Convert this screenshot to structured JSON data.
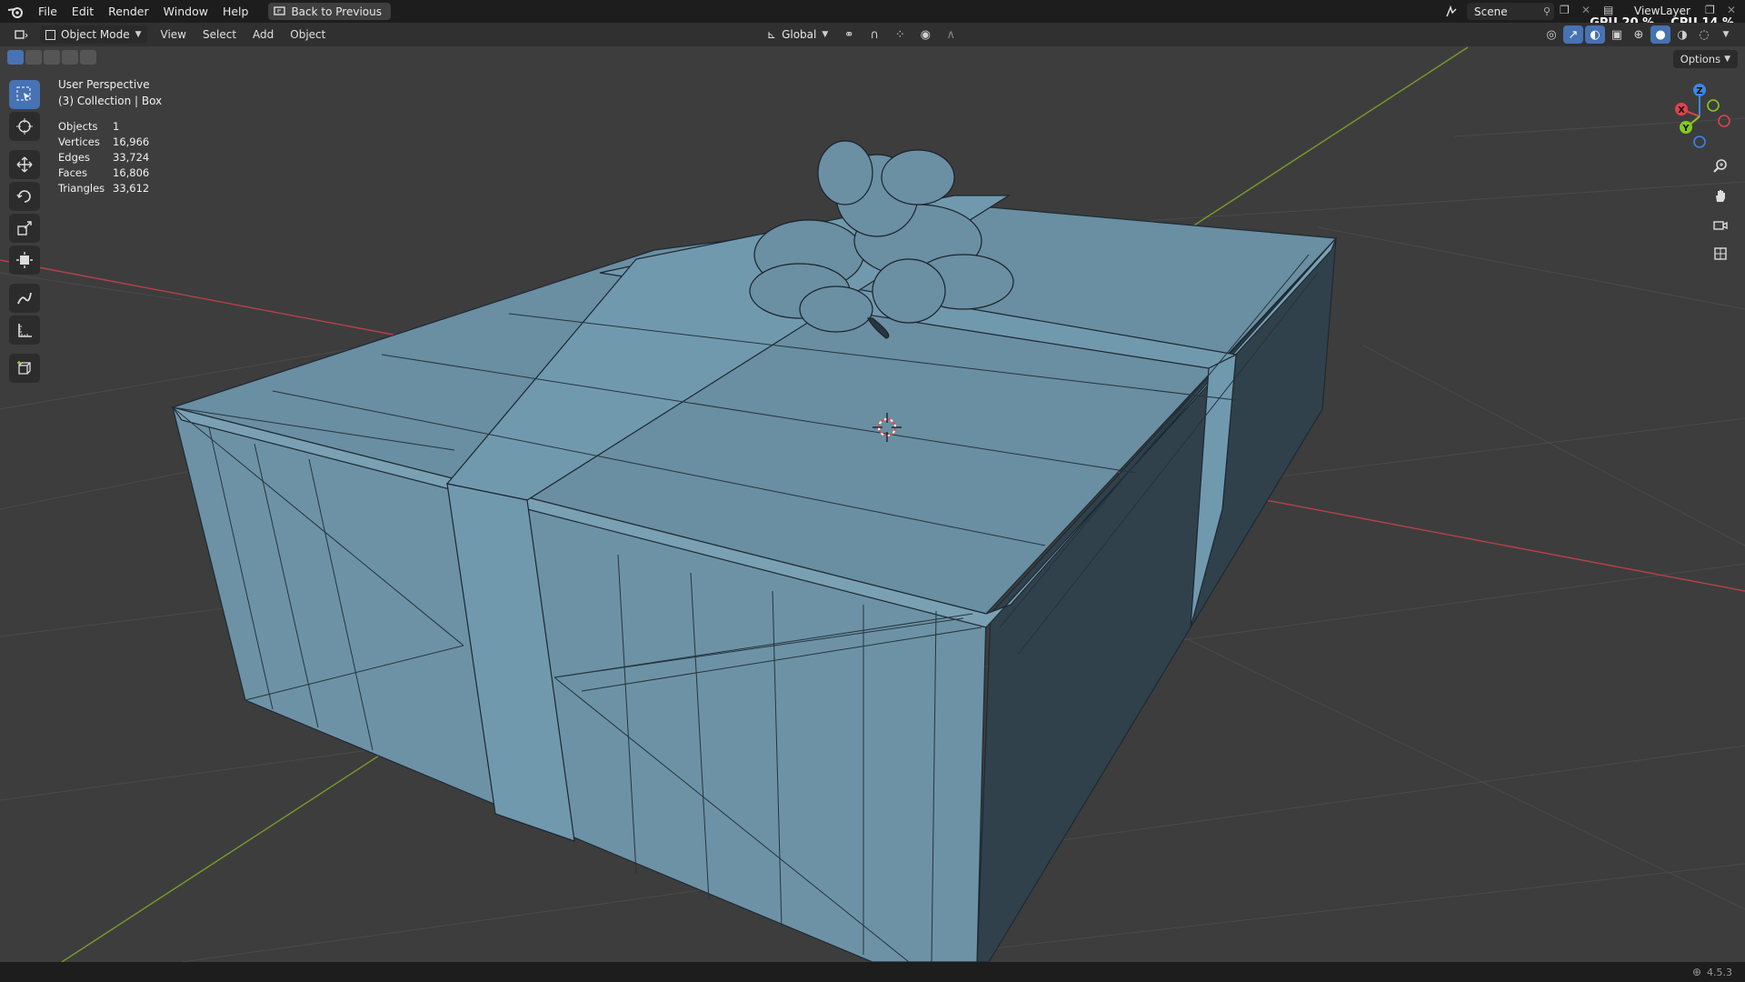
{
  "menu": {
    "file": "File",
    "edit": "Edit",
    "render": "Render",
    "window": "Window",
    "help": "Help",
    "back_to_previous": "Back to Previous"
  },
  "scene": {
    "label": "Scene"
  },
  "view_layer": {
    "label": "ViewLayer"
  },
  "performance": {
    "gpu_label": "GPU",
    "gpu_value": "20 %",
    "cpu_label": "CPU",
    "cpu_value": "14 %"
  },
  "header": {
    "mode": "Object Mode",
    "view": "View",
    "select": "Select",
    "add": "Add",
    "object": "Object",
    "transform_orientation": "Global",
    "options": "Options"
  },
  "viewport": {
    "perspective": "User Perspective",
    "collection": "(3) Collection | Box",
    "stats": [
      {
        "label": "Objects",
        "value": "1"
      },
      {
        "label": "Vertices",
        "value": "16,966"
      },
      {
        "label": "Edges",
        "value": "33,724"
      },
      {
        "label": "Faces",
        "value": "16,806"
      },
      {
        "label": "Triangles",
        "value": "33,612"
      }
    ],
    "gizmo": {
      "x": "X",
      "y": "Y",
      "z": "Z"
    }
  },
  "status": {
    "version": "4.5.3"
  },
  "colors": {
    "accent": "#4772b3",
    "x_axis": "#e0434d",
    "y_axis": "#85c91e",
    "z_axis": "#3a87e8",
    "box_face": "#6f93a8",
    "box_shadow": "#2c3a42"
  }
}
